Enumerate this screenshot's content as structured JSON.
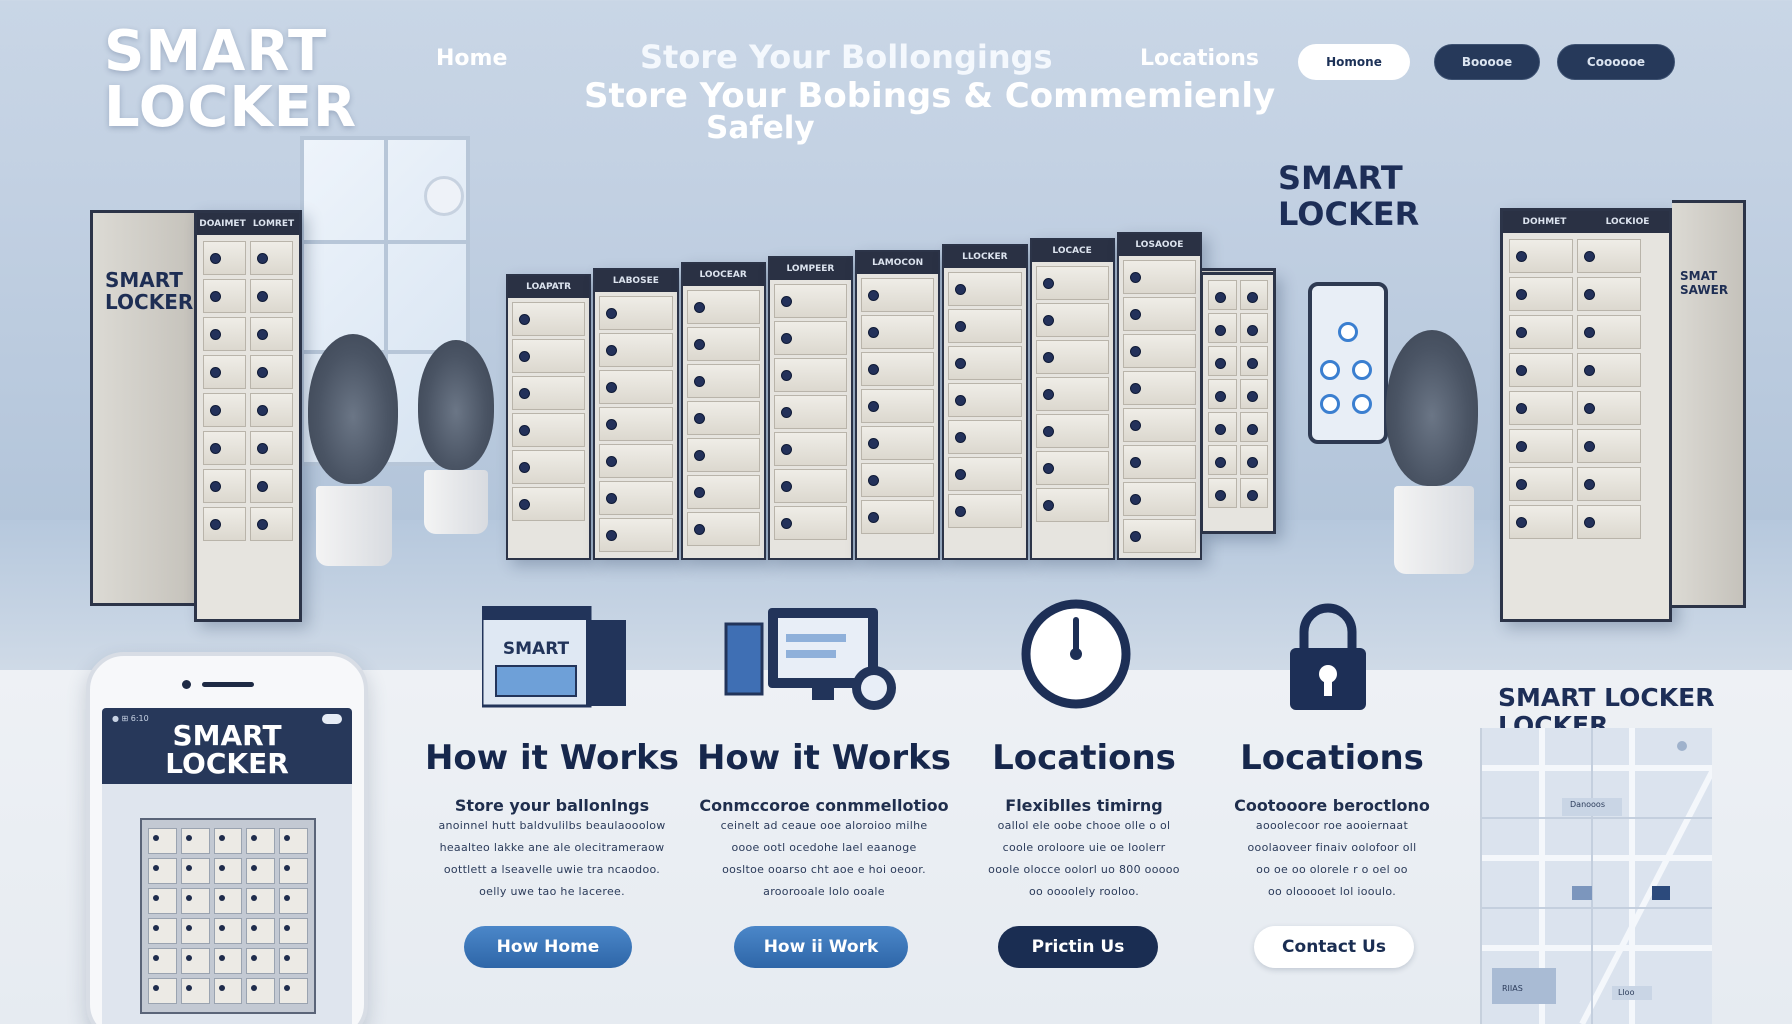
{
  "header": {
    "brand_line1": "SMART",
    "brand_line2": "LOCKER",
    "nav_home": "Home",
    "nav_locations": "Locations",
    "hero_line1": "Store Your Bollongings",
    "hero_line2": "Store Your Bobings & Commemienly",
    "hero_line3": "Safely",
    "hero_sub": "",
    "buttons": [
      {
        "label": "Homone",
        "style": "white"
      },
      {
        "label": "Booooe",
        "style": "dark"
      },
      {
        "label": "Coooooe",
        "style": "dark"
      }
    ]
  },
  "scene": {
    "left_tower_label_1": "SMART",
    "left_tower_label_2": "LOCKER",
    "left_tower_heads": [
      "DOAIMET",
      "LOMRET"
    ],
    "center_heads": [
      "LOAPATR",
      "LABOSEE",
      "LOOCEAR",
      "LOMPEER",
      "LAMOCON",
      "LLOCKER",
      "LOCACE",
      "LOSAOOE"
    ],
    "right_title_1": "SMART",
    "right_title_2": "LOCKER",
    "right_tower_heads": [
      "DOHMET",
      "LOCKIOE"
    ],
    "right_tower_side": "SMAT SAWER"
  },
  "phone": {
    "status": "● ⊞ 6:10",
    "title_1": "SMART",
    "title_2": "LOCKER"
  },
  "features": [
    {
      "icon": "smart-locker-box-icon",
      "icon_text": "SMART",
      "title": "How it Works",
      "subtitle": "Store your ballonlngs",
      "lines": [
        "anoinnel hutt baldvulilbs beaulaooolow",
        "heaalteo lakke ane ale olecitrameraow",
        "oottlett a lseavelle uwie tra ncaodoo.",
        "oelly uwe tao he laceree."
      ],
      "cta": "How Home",
      "cta_style": "blue"
    },
    {
      "icon": "computer-locker-icon",
      "title": "How it Works",
      "subtitle": "Conmccoroe conmmellotioo",
      "lines": [
        "ceinelt ad ceaue ooe aloroioo milhe",
        "oooe ootl ocedohe lael eaanoge",
        "oosltoe ooarso cht aoe e hoi oeoor.",
        "aroorooale lolo ooale"
      ],
      "cta": "How ii Work",
      "cta_style": "blue"
    },
    {
      "icon": "clock-icon",
      "title": "Locations",
      "subtitle": "Flexiblles timirng",
      "lines": [
        "oallol ele oobe chooe olle o ol",
        "coole oroloore uie oe loolerr",
        "ooole olocce oolorl uo 800 ooooo",
        "oo oooolely rooloo."
      ],
      "cta": "Prictin Us",
      "cta_style": "navy"
    },
    {
      "icon": "padlock-icon",
      "title": "Locations",
      "subtitle": "Cootooore beroctlono",
      "lines": [
        "aooolecoor roe aooiernaat",
        "ooolaoveer finaiv oolofoor oll",
        "oo oe oo olorele r o oel oo",
        "oo olooooet lol iooulo."
      ],
      "cta": "Contact Us",
      "cta_style": "white"
    }
  ],
  "map": {
    "title_1": "SMART LOCKER",
    "title_2": "LOCKER",
    "tag1": "Danooos",
    "tag2": "RIIAS",
    "tag3": "Lloo"
  }
}
